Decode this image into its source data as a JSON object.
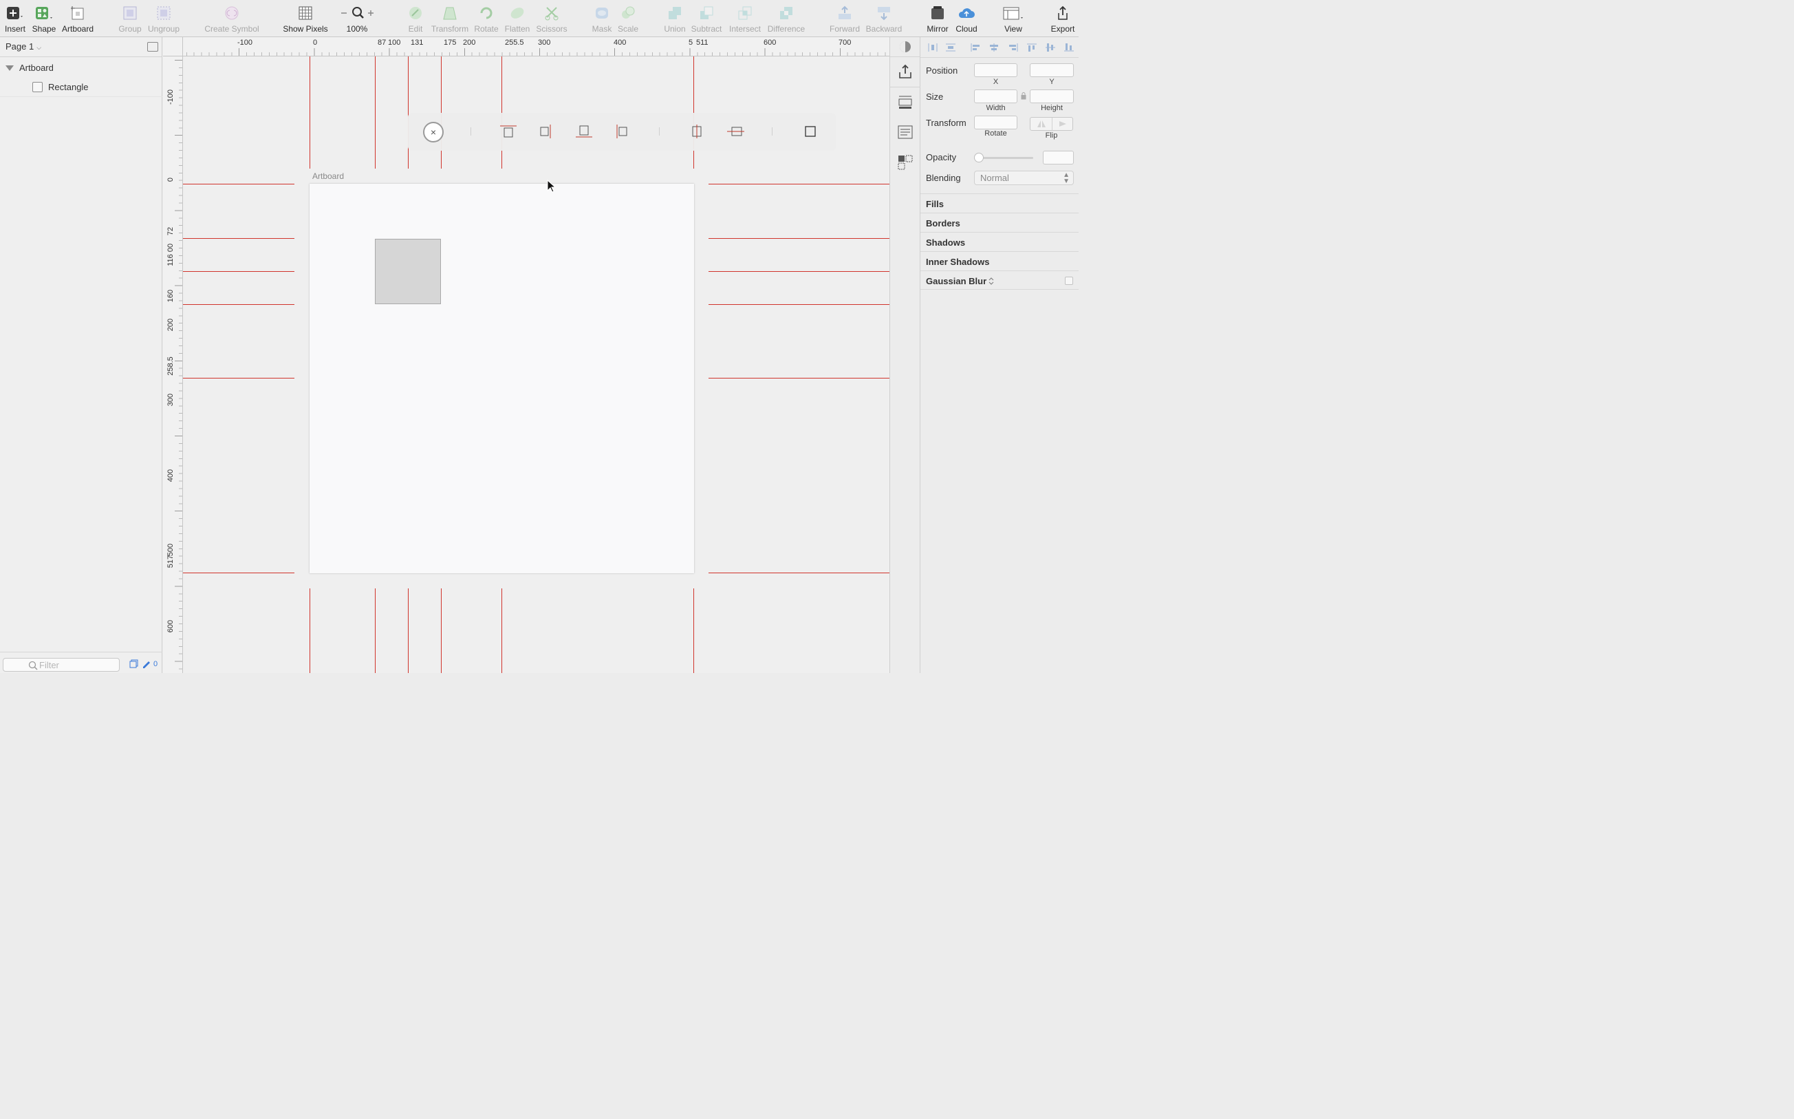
{
  "toolbar": {
    "insert": "Insert",
    "shape": "Shape",
    "artboard": "Artboard",
    "group": "Group",
    "ungroup": "Ungroup",
    "create_symbol": "Create Symbol",
    "show_pixels": "Show Pixels",
    "zoom": "100%",
    "edit": "Edit",
    "transform": "Transform",
    "rotate": "Rotate",
    "flatten": "Flatten",
    "scissors": "Scissors",
    "mask": "Mask",
    "scale": "Scale",
    "union": "Union",
    "subtract": "Subtract",
    "intersect": "Intersect",
    "difference": "Difference",
    "forward": "Forward",
    "backward": "Backward",
    "mirror": "Mirror",
    "cloud": "Cloud",
    "view": "View",
    "export": "Export"
  },
  "sidebar": {
    "page": "Page 1",
    "layers": [
      {
        "name": "Artboard"
      },
      {
        "name": "Rectangle"
      }
    ],
    "filter_placeholder": "Filter",
    "edit_count": "0"
  },
  "canvas": {
    "ruler_top": [
      "-100",
      "0",
      "87",
      "100",
      "131",
      "175",
      "200",
      "255.5",
      "300",
      "400",
      "5",
      "511",
      "600",
      "700"
    ],
    "ruler_left": [
      "-100",
      "0",
      "72",
      "116",
      "00",
      "160",
      "200",
      "258.5",
      "300",
      "400",
      "517",
      "500",
      "600"
    ],
    "artboard_label": "Artboard"
  },
  "inspector": {
    "position_label": "Position",
    "x_label": "X",
    "y_label": "Y",
    "size_label": "Size",
    "width_label": "Width",
    "height_label": "Height",
    "transform_label": "Transform",
    "rotate_label": "Rotate",
    "flip_label": "Flip",
    "opacity_label": "Opacity",
    "blending_label": "Blending",
    "blending_value": "Normal",
    "sections": [
      "Fills",
      "Borders",
      "Shadows",
      "Inner Shadows",
      "Gaussian Blur"
    ]
  }
}
